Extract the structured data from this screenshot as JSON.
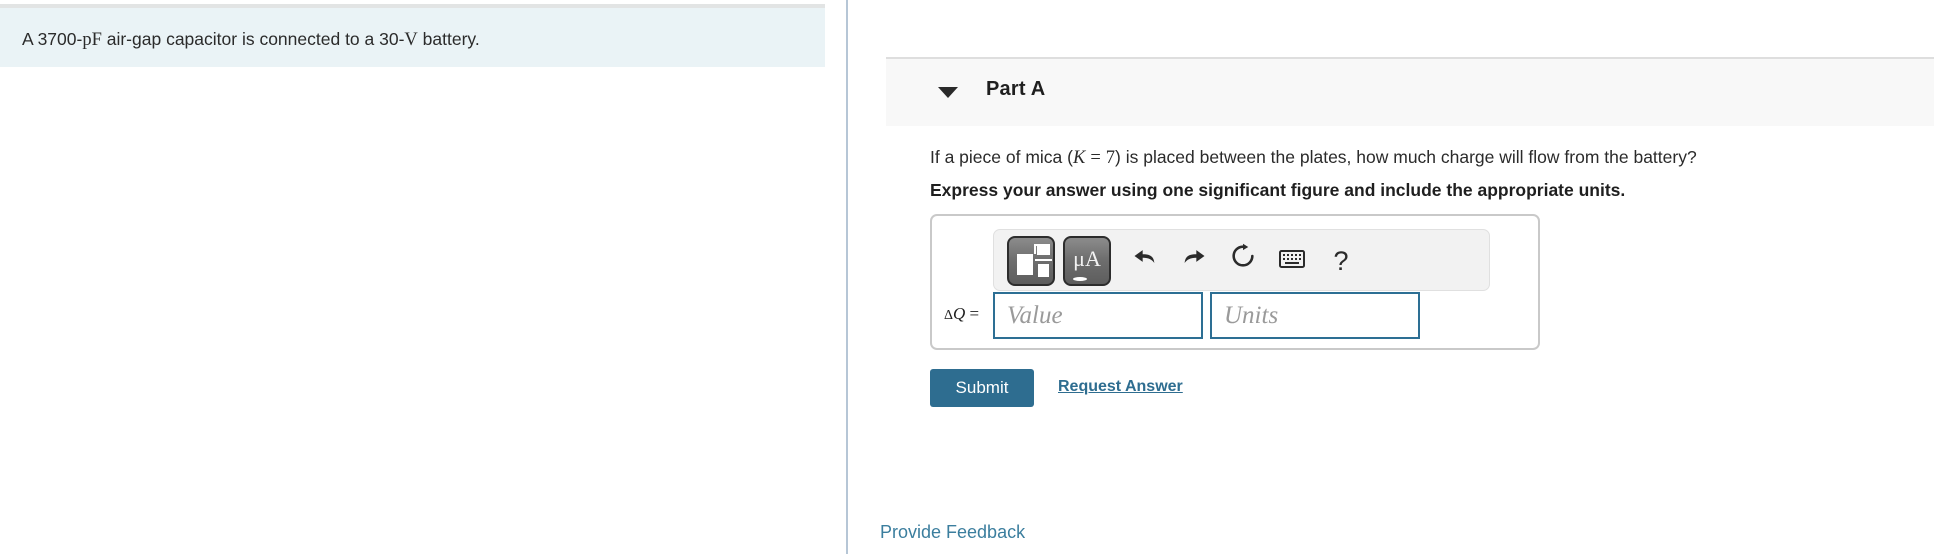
{
  "problem": {
    "text_before_pf": "A 3700-",
    "unit_pf": "pF",
    "text_middle": " air-gap capacitor is connected to a 30-",
    "unit_v": "V",
    "text_after": " battery."
  },
  "part": {
    "title": "Part A",
    "disclosure_icon": "triangle-down-icon",
    "question_prefix": "If a piece of mica (",
    "question_variable": "K",
    "question_equals": "=",
    "question_value": "7",
    "question_suffix": ") is placed between the plates, how much charge will flow from the battery?",
    "instruction": "Express your answer using one significant figure and include the appropriate units."
  },
  "answer": {
    "label_delta": "Δ",
    "label_variable": "Q",
    "label_equals": " =",
    "value_placeholder": "Value",
    "units_placeholder": "Units",
    "value_current": "",
    "units_current": ""
  },
  "toolbar": {
    "template_button_icon": "math-template-icon",
    "unit_button_label": "μA",
    "undo_icon": "⬅",
    "undo_name": "undo-icon",
    "redo_icon": "➡",
    "redo_name": "redo-icon",
    "reset_icon": "↻",
    "reset_name": "reset-icon",
    "keyboard_icon": "⌨",
    "keyboard_name": "keyboard-icon",
    "help_icon": "?",
    "help_name": "help-icon"
  },
  "actions": {
    "submit_label": "Submit",
    "request_answer_label": "Request Answer",
    "provide_feedback_label": "Provide Feedback"
  },
  "colors": {
    "problem_bg": "#eaf3f6",
    "part_header_bg": "#f8f8f8",
    "accent_blue": "#2e6d90",
    "input_border": "#2d6f94",
    "link_blue": "#3b7e9e",
    "divider": "#b6c6d6"
  }
}
